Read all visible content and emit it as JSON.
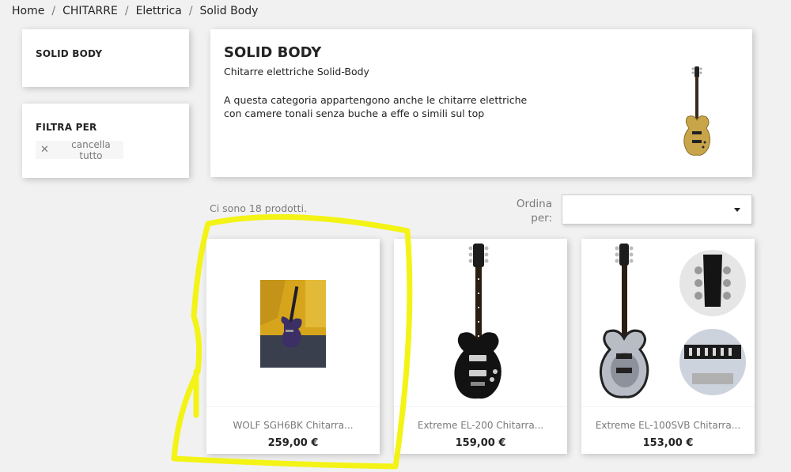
{
  "breadcrumb": [
    "Home",
    "CHITARRE",
    "Elettrica",
    "Solid Body"
  ],
  "sidebar": {
    "category_title": "SOLID BODY",
    "filter_title": "FILTRA PER",
    "clear_all_label": "cancella tutto",
    "clear_icon": "close-icon"
  },
  "category": {
    "title": "SOLID BODY",
    "subtitle": "Chitarre elettriche Solid-Body",
    "description": "A questa categoria appartengono anche le chitarre elettriche con camere tonali senza buche a effe o simili sul top"
  },
  "listing": {
    "count_text": "Ci sono 18 prodotti.",
    "sort_label": "Ordina per:",
    "sort_value": ""
  },
  "products": [
    {
      "name": "WOLF SGH6BK Chitarra...",
      "price": "259,00 €"
    },
    {
      "name": "Extreme EL-200 Chitarra...",
      "price": "159,00 €"
    },
    {
      "name": "Extreme EL-100SVB Chitarra...",
      "price": "153,00 €"
    }
  ],
  "colors": {
    "background": "#f1f1f1",
    "card": "#ffffff",
    "text": "#232323",
    "muted": "#7a7a7a",
    "highlight": "#f2f20a",
    "gold_guitar": "#c9a54a"
  }
}
